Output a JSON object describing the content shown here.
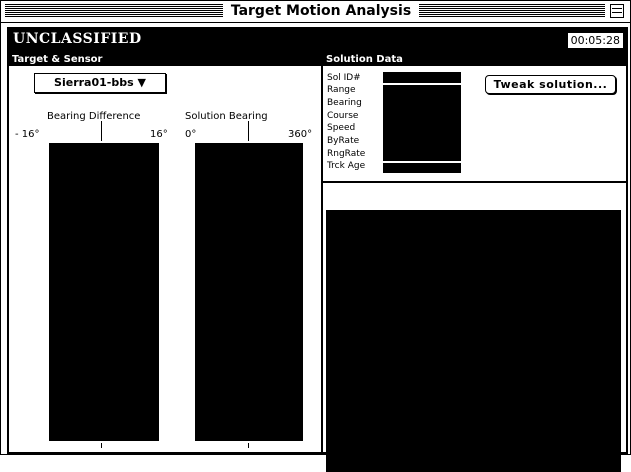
{
  "window": {
    "title": "Target Motion Analysis"
  },
  "classification": {
    "label": "UNCLASSIFIED",
    "timer": "00:05:28"
  },
  "target_sensor": {
    "header": "Target & Sensor",
    "selected": "Sierra01-bbs ▼",
    "bearing_difference": {
      "caption": "Bearing Difference",
      "min_label": "- 16°",
      "max_label": "16°"
    },
    "solution_bearing": {
      "caption": "Solution Bearing",
      "min_label": "0°",
      "max_label": "360°"
    }
  },
  "solution_data": {
    "header": "Solution Data",
    "fields": [
      "Sol ID#",
      "Range",
      "Bearing",
      "Course",
      "Speed",
      "ByRate",
      "RngRate",
      "Trck Age"
    ],
    "tweak_button": "Tweak solution..."
  }
}
